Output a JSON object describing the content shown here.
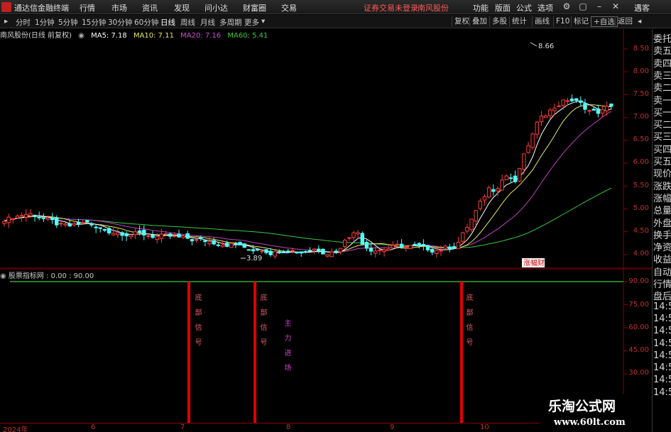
{
  "app": {
    "title": "通达信金融终端"
  },
  "menu": [
    "行情",
    "市场",
    "资讯",
    "发现",
    "问小达",
    "财富圈",
    "交易"
  ],
  "notice": {
    "login": "证券交易未登录",
    "stock": "南风股份"
  },
  "topright": [
    "功能",
    "版面",
    "公式",
    "选项",
    "遇客"
  ],
  "periods": [
    "分时",
    "1分钟",
    "5分钟",
    "15分钟",
    "30分钟",
    "60分钟",
    "日线",
    "周线",
    "月线",
    "多周期",
    "更多"
  ],
  "active_period": "日线",
  "toolbar_right": [
    "复权",
    "叠加",
    "多股",
    "统计",
    "画线",
    "F10",
    "标记",
    "+自选",
    "返回"
  ],
  "chart_header": {
    "stock_label": "南风股份(日线 前复权)",
    "ma5": "MA5: 7.18",
    "ma10": "MA10: 7.11",
    "ma20": "MA20: 7.16",
    "ma60": "MA60: 5.41"
  },
  "price_axis": [
    "8.50",
    "8.00",
    "7.50",
    "7.00",
    "6.50",
    "6.00",
    "5.50",
    "5.00",
    "4.50",
    "4.00"
  ],
  "annotations": {
    "high": "8.66",
    "low": "3.89",
    "tag": "涨幅财"
  },
  "indicator": {
    "header": "股票指标网 : 0.00 : 90.00",
    "axis": [
      "90.00",
      "75.00",
      "60.00",
      "45.00",
      "30.00"
    ],
    "signals": [
      {
        "text": "底部信号"
      },
      {
        "text": "底部信号"
      },
      {
        "text": "主力进场"
      },
      {
        "text": "底部信号"
      }
    ]
  },
  "dates": [
    "2024年",
    "6",
    "7",
    "8",
    "9",
    "10"
  ],
  "right_panel": [
    "委托",
    "卖五",
    "卖四",
    "卖三",
    "卖二",
    "卖一",
    "买一",
    "买二",
    "买三",
    "买四",
    "买五",
    "现价",
    "涨跌",
    "涨幅",
    "总量",
    "外盘",
    "换手",
    "净资",
    "收益",
    "自动",
    "行情",
    "盘后",
    "14:5",
    "14:5",
    "14:5",
    "14:5",
    "14:5",
    "14:5",
    "14:5",
    "14:5"
  ],
  "watermark": {
    "cn": "乐淘公式网",
    "url": "www.60lt.com"
  },
  "colors": {
    "up": "#ff3b3b",
    "down": "#54ffff",
    "ma5": "#ffffff",
    "ma10": "#e8e85a",
    "ma20": "#c040c0",
    "ma60": "#3cc83c",
    "signal": "#e00000",
    "accent_text": "#c03030"
  }
}
